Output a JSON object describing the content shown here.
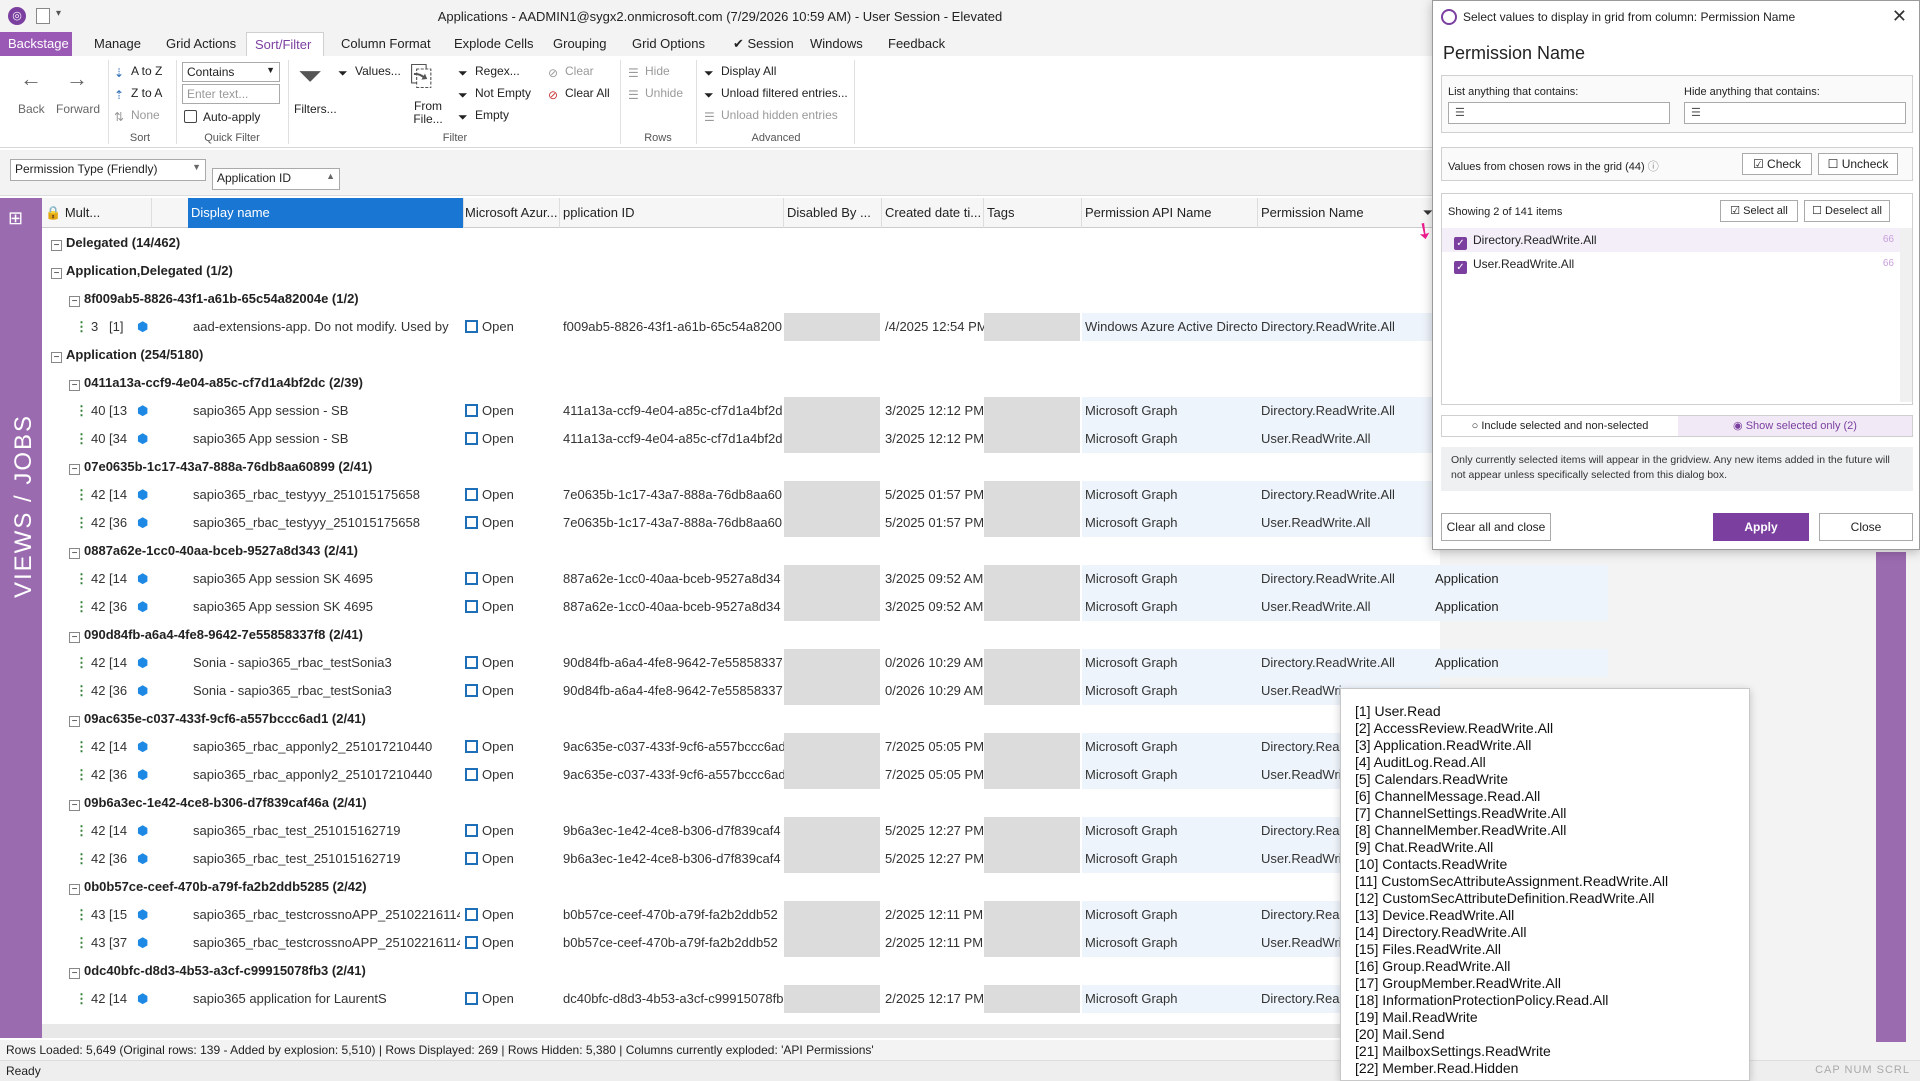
{
  "window": {
    "title": "Applications - AADMIN1@sygx2.onmicrosoft.com (7/29/2026 10:59 AM) - User Session - Elevated"
  },
  "tabs": [
    "Backstage",
    "Manage",
    "Grid Actions",
    "Sort/Filter",
    "Column Format",
    "Explode Cells",
    "Grouping",
    "Grid Options",
    "Session",
    "Windows",
    "Feedback"
  ],
  "ribbon": {
    "back": "Back",
    "forward": "Forward",
    "a_to_z": "A to Z",
    "z_to_a": "Z to A",
    "none": "None",
    "sort_group": "Sort",
    "contains": "Contains",
    "enter_text": "Enter text...",
    "auto_apply": "Auto-apply",
    "quick_filter_group": "Quick Filter",
    "filters": "Filters...",
    "values": "Values...",
    "from_file": "From File...",
    "regex": "Regex...",
    "not_empty": "Not Empty",
    "empty": "Empty",
    "clear": "Clear",
    "clear_all": "Clear All",
    "filter_group": "Filter",
    "hide": "Hide",
    "unhide": "Unhide",
    "rows_group": "Rows",
    "display_all": "Display All",
    "unload_filtered": "Unload filtered entries...",
    "unload_hidden": "Unload hidden entries",
    "advanced_group": "Advanced"
  },
  "field_chips": {
    "permission_type": "Permission Type (Friendly)",
    "application_id": "Application ID"
  },
  "sidetab": "VIEWS / JOBS",
  "columns": {
    "mult": "Mult...",
    "display_name": "Display name",
    "ms_azure": "Microsoft Azur...",
    "app_id": "pplication ID",
    "disabled_by": "Disabled By ...",
    "created": "Created date ti...",
    "tags": "Tags",
    "perm_api": "Permission API Name",
    "perm_name": "Permission Name"
  },
  "rows": [
    {
      "kind": "g1",
      "label": "Delegated (14/462)"
    },
    {
      "kind": "g1",
      "label": "Application,Delegated (1/2)"
    },
    {
      "kind": "g2",
      "label": "8f009ab5-8826-43f1-a61b-65c54a82004e (1/2)"
    },
    {
      "kind": "d",
      "n": "3",
      "idx": "[1]",
      "name": "aad-extensions-app. Do not modify. Used by",
      "open": "Open",
      "appid": "f009ab5-8826-43f1-a61b-65c54a8200",
      "created": "/4/2025 12:54 PM",
      "api": "Windows Azure Active Directo",
      "perm": "Directory.ReadWrite.All",
      "extra": "",
      "dim": false
    },
    {
      "kind": "g1",
      "label": "Application (254/5180)"
    },
    {
      "kind": "g2",
      "label": "0411a13a-ccf9-4e04-a85c-cf7d1a4bf2dc (2/39)"
    },
    {
      "kind": "d",
      "n": "40",
      "idx": "[13",
      "name": "sapio365 App session - SB",
      "open": "Open",
      "appid": "411a13a-ccf9-4e04-a85c-cf7d1a4bf2d",
      "created": "3/2025 12:12 PM",
      "api": "Microsoft Graph",
      "perm": "Directory.ReadWrite.All",
      "extra": "",
      "dim": true
    },
    {
      "kind": "d",
      "n": "40",
      "idx": "[34",
      "name": "sapio365 App session - SB",
      "open": "Open",
      "appid": "411a13a-ccf9-4e04-a85c-cf7d1a4bf2d",
      "created": "3/2025 12:12 PM",
      "api": "Microsoft Graph",
      "perm": "User.ReadWrite.All",
      "extra": "",
      "dim": true
    },
    {
      "kind": "g2",
      "label": "07e0635b-1c17-43a7-888a-76db8aa60899 (2/41)"
    },
    {
      "kind": "d",
      "n": "42",
      "idx": "[14",
      "name": "sapio365_rbac_testyyy_251015175658",
      "open": "Open",
      "appid": "7e0635b-1c17-43a7-888a-76db8aa60",
      "created": "5/2025 01:57 PM",
      "api": "Microsoft Graph",
      "perm": "Directory.ReadWrite.All",
      "extra": "",
      "dim": true
    },
    {
      "kind": "d",
      "n": "42",
      "idx": "[36",
      "name": "sapio365_rbac_testyyy_251015175658",
      "open": "Open",
      "appid": "7e0635b-1c17-43a7-888a-76db8aa60",
      "created": "5/2025 01:57 PM",
      "api": "Microsoft Graph",
      "perm": "User.ReadWrite.All",
      "extra": "",
      "dim": true
    },
    {
      "kind": "g2",
      "label": "0887a62e-1cc0-40aa-bceb-9527a8d343 (2/41)"
    },
    {
      "kind": "d",
      "n": "42",
      "idx": "[14",
      "name": "sapio365 App session SK 4695",
      "open": "Open",
      "appid": "887a62e-1cc0-40aa-bceb-9527a8d34",
      "created": "3/2025 09:52 AM",
      "api": "Microsoft Graph",
      "perm": "Directory.ReadWrite.All",
      "extra": "Application",
      "dim": true
    },
    {
      "kind": "d",
      "n": "42",
      "idx": "[36",
      "name": "sapio365 App session SK 4695",
      "open": "Open",
      "appid": "887a62e-1cc0-40aa-bceb-9527a8d34",
      "created": "3/2025 09:52 AM",
      "api": "Microsoft Graph",
      "perm": "User.ReadWrite.All",
      "extra": "Application",
      "dim": true
    },
    {
      "kind": "g2",
      "label": "090d84fb-a6a4-4fe8-9642-7e55858337f8 (2/41)"
    },
    {
      "kind": "d",
      "n": "42",
      "idx": "[14",
      "name": "Sonia - sapio365_rbac_testSonia3",
      "open": "Open",
      "appid": "90d84fb-a6a4-4fe8-9642-7e55858337",
      "created": "0/2026 10:29 AM",
      "api": "Microsoft Graph",
      "perm": "Directory.ReadWrite.All",
      "extra": "Application",
      "dim": true
    },
    {
      "kind": "d",
      "n": "42",
      "idx": "[36",
      "name": "Sonia - sapio365_rbac_testSonia3",
      "open": "Open",
      "appid": "90d84fb-a6a4-4fe8-9642-7e55858337",
      "created": "0/2026 10:29 AM",
      "api": "Microsoft Graph",
      "perm": "User.ReadWri",
      "extra": "",
      "dim": true
    },
    {
      "kind": "g2",
      "label": "09ac635e-c037-433f-9cf6-a557bccc6ad1 (2/41)"
    },
    {
      "kind": "d",
      "n": "42",
      "idx": "[14",
      "name": "sapio365_rbac_apponly2_251017210440",
      "open": "Open",
      "appid": "9ac635e-c037-433f-9cf6-a557bccc6ad",
      "created": "7/2025 05:05 PM",
      "api": "Microsoft Graph",
      "perm": "Directory.Rea",
      "extra": "",
      "dim": true
    },
    {
      "kind": "d",
      "n": "42",
      "idx": "[36",
      "name": "sapio365_rbac_apponly2_251017210440",
      "open": "Open",
      "appid": "9ac635e-c037-433f-9cf6-a557bccc6ad",
      "created": "7/2025 05:05 PM",
      "api": "Microsoft Graph",
      "perm": "User.ReadWri",
      "extra": "",
      "dim": true
    },
    {
      "kind": "g2",
      "label": "09b6a3ec-1e42-4ce8-b306-d7f839caf46a (2/41)"
    },
    {
      "kind": "d",
      "n": "42",
      "idx": "[14",
      "name": "sapio365_rbac_test_251015162719",
      "open": "Open",
      "appid": "9b6a3ec-1e42-4ce8-b306-d7f839caf4",
      "created": "5/2025 12:27 PM",
      "api": "Microsoft Graph",
      "perm": "Directory.Rea",
      "extra": "",
      "dim": true
    },
    {
      "kind": "d",
      "n": "42",
      "idx": "[36",
      "name": "sapio365_rbac_test_251015162719",
      "open": "Open",
      "appid": "9b6a3ec-1e42-4ce8-b306-d7f839caf4",
      "created": "5/2025 12:27 PM",
      "api": "Microsoft Graph",
      "perm": "User.ReadWri",
      "extra": "",
      "dim": true
    },
    {
      "kind": "g2",
      "label": "0b0b57ce-ceef-470b-a79f-fa2b2ddb5285 (2/42)"
    },
    {
      "kind": "d",
      "n": "43",
      "idx": "[15",
      "name": "sapio365_rbac_testcrossnoAPP_25102216114",
      "open": "Open",
      "appid": "b0b57ce-ceef-470b-a79f-fa2b2ddb52",
      "created": "2/2025 12:11 PM",
      "api": "Microsoft Graph",
      "perm": "Directory.Rea",
      "extra": "",
      "dim": true
    },
    {
      "kind": "d",
      "n": "43",
      "idx": "[37",
      "name": "sapio365_rbac_testcrossnoAPP_25102216114",
      "open": "Open",
      "appid": "b0b57ce-ceef-470b-a79f-fa2b2ddb52",
      "created": "2/2025 12:11 PM",
      "api": "Microsoft Graph",
      "perm": "User.ReadWri",
      "extra": "",
      "dim": true
    },
    {
      "kind": "g2",
      "label": "0dc40bfc-d8d3-4b53-a3cf-c99915078fb3 (2/41)"
    },
    {
      "kind": "d",
      "n": "42",
      "idx": "[14",
      "name": "sapio365 application for LaurentS",
      "open": "Open",
      "appid": "dc40bfc-d8d3-4b53-a3cf-c99915078fb",
      "created": "2/2025 12:17 PM",
      "api": "Microsoft Graph",
      "perm": "Directory.Rea",
      "extra": "",
      "dim": true
    }
  ],
  "status": {
    "line1": "Rows Loaded: 5,649 (Original rows: 139 - Added by explosion: 5,510) | Rows Displayed: 269 | Rows Hidden: 5,380 | Columns currently exploded: 'API Permissions'",
    "line2": "Ready",
    "caps": "CAP  NUM  SCRL"
  },
  "dialog": {
    "title": "Select values to display in grid from column: Permission Name",
    "heading": "Permission Name",
    "list_contains": "List anything that contains:",
    "hide_contains": "Hide anything that contains:",
    "values_from_rows": "Values from chosen rows in the grid (44)",
    "check": "Check",
    "uncheck": "Uncheck",
    "showing": "Showing 2 of 141 items",
    "select_all": "Select all",
    "deselect_all": "Deselect all",
    "items": [
      {
        "label": "Directory.ReadWrite.All",
        "count": "66"
      },
      {
        "label": "User.ReadWrite.All",
        "count": "66"
      }
    ],
    "include_selected": "Include selected and non-selected",
    "show_selected": "Show selected only (2)",
    "note": "Only currently selected items will appear in the gridview. Any new items added in the future will not appear unless specifically selected from this dialog box.",
    "clear_close": "Clear all and close",
    "apply": "Apply",
    "close": "Close"
  },
  "tooltip": [
    "[1] User.Read",
    "[2] AccessReview.ReadWrite.All",
    "[3] Application.ReadWrite.All",
    "[4] AuditLog.Read.All",
    "[5] Calendars.ReadWrite",
    "[6] ChannelMessage.Read.All",
    "[7] ChannelSettings.ReadWrite.All",
    "[8] ChannelMember.ReadWrite.All",
    "[9] Chat.ReadWrite.All",
    "[10] Contacts.ReadWrite",
    "[11] CustomSecAttributeAssignment.ReadWrite.All",
    "[12] CustomSecAttributeDefinition.ReadWrite.All",
    "[13] Device.ReadWrite.All",
    "[14] Directory.ReadWrite.All",
    "[15] Files.ReadWrite.All",
    "[16] Group.ReadWrite.All",
    "[17] GroupMember.ReadWrite.All",
    "[18] InformationProtectionPolicy.Read.All",
    "[19] Mail.ReadWrite",
    "[20] Mail.Send",
    "[21] MailboxSettings.ReadWrite",
    "[22] Member.Read.Hidden"
  ]
}
